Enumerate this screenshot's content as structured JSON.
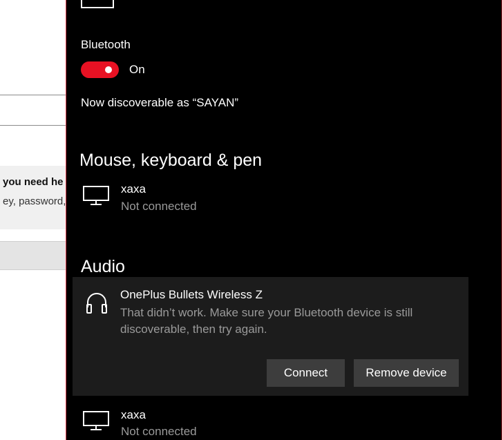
{
  "background_window": {
    "partial_heading": "you need he",
    "partial_text": "ey, password,"
  },
  "bluetooth": {
    "label": "Bluetooth",
    "toggle_state": "On",
    "discoverable_text": "Now discoverable as “SAYAN”",
    "accent_color": "#e81123"
  },
  "sections": {
    "mouse_keyboard_pen": {
      "title": "Mouse, keyboard & pen",
      "devices": [
        {
          "name": "xaxa",
          "status": "Not connected",
          "icon": "monitor-icon"
        }
      ]
    },
    "audio": {
      "title": "Audio",
      "selected_device": {
        "name": "OnePlus Bullets Wireless Z",
        "message": "That didn’t work. Make sure your Bluetooth device is still discoverable, then try again.",
        "icon": "headphones-icon",
        "connect_label": "Connect",
        "remove_label": "Remove device"
      },
      "devices": [
        {
          "name": "xaxa",
          "status": "Not connected",
          "icon": "monitor-icon"
        }
      ]
    }
  }
}
